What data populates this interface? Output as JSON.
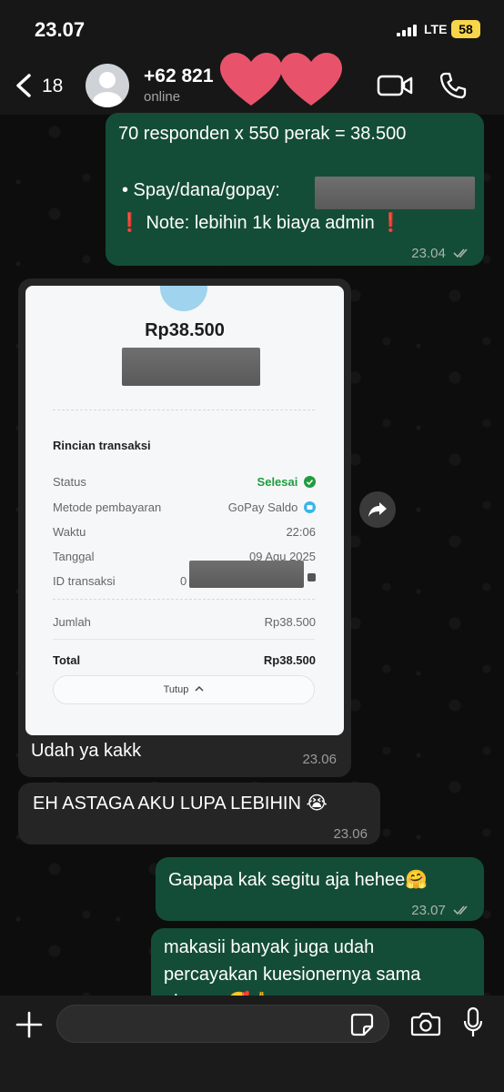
{
  "status_bar": {
    "time": "23.07",
    "network": "LTE",
    "battery": "58"
  },
  "header": {
    "back_count": "18",
    "contact_name": "+62 821",
    "contact_status": "online"
  },
  "messages": [
    {
      "direction": "outgoing",
      "line1": "70 responden  x 550 perak = 38.500",
      "line2": "• Spay/dana/gopay: ",
      "line3": "❗ Note: lebihin 1k biaya admin ❗",
      "time": "23.04",
      "read": true
    },
    {
      "direction": "incoming",
      "caption": "Udah ya kakk",
      "time": "23.06",
      "receipt": {
        "amount": "Rp38.500",
        "section_title": "Rincian transaksi",
        "rows": [
          {
            "label": "Status",
            "value": "Selesai"
          },
          {
            "label": "Metode pembayaran",
            "value": "GoPay Saldo"
          },
          {
            "label": "Waktu",
            "value": "22:06"
          },
          {
            "label": "Tanggal",
            "value": "09 Agu 2025"
          },
          {
            "label": "ID transaksi",
            "value": "0"
          }
        ],
        "jumlah_label": "Jumlah",
        "jumlah_value": "Rp38.500",
        "total_label": "Total",
        "total_value": "Rp38.500",
        "close_label": "Tutup"
      }
    },
    {
      "direction": "incoming",
      "text": "EH ASTAGA AKU LUPA LEBIHIN 😭",
      "time": "23.06"
    },
    {
      "direction": "outgoing",
      "text": "Gapapa kak segitu aja hehee🤗",
      "time": "23.07",
      "read": true
    },
    {
      "direction": "outgoing",
      "line1": "makasii banyak juga udah",
      "line2": "percayakan kuesionernya sama",
      "line3": "aku yaa🥰🙏"
    }
  ],
  "input_bar": {
    "placeholder": ""
  },
  "colors": {
    "outgoing_bubble": "#144d37",
    "incoming_bubble": "#252525",
    "success_green": "#1f9c3e",
    "battery_yellow": "#f7d64a",
    "heart_pink": "#e8536b"
  },
  "icons": [
    "back-chevron-icon",
    "avatar-placeholder-icon",
    "heart-sticker",
    "video-call-icon",
    "phone-call-icon",
    "read-ticks-icon",
    "check-circle-icon",
    "gopay-icon",
    "chevron-up-icon",
    "share-icon",
    "plus-icon",
    "sticker-icon",
    "camera-icon",
    "mic-icon"
  ]
}
